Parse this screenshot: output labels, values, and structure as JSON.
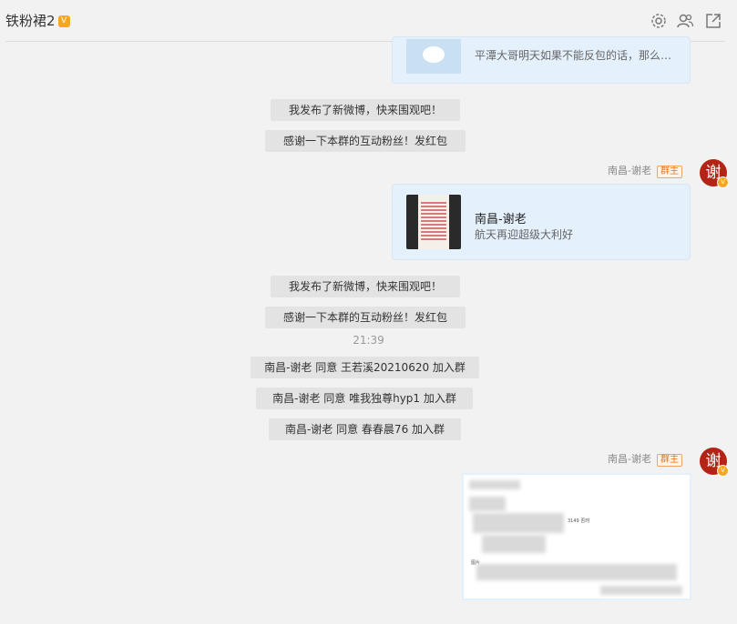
{
  "header": {
    "title": "铁粉裙2",
    "settings_icon": "gear-icon",
    "members_icon": "people-icon",
    "popout_icon": "external-link-icon"
  },
  "top_card": {
    "subtitle": "平潭大哥明天如果不能反包的话，那么…"
  },
  "system_messages": [
    "我发布了新微博，快来围观吧！",
    "感谢一下本群的互动粉丝！发红包",
    "我发布了新微博，快来围观吧！",
    "感谢一下本群的互动粉丝！发红包"
  ],
  "sender_1": {
    "name": "南昌-谢老",
    "role": "群主"
  },
  "card_1": {
    "title": "南昌-谢老",
    "subtitle": "航天再迎超级大利好"
  },
  "time_label": "21:39",
  "join_messages": [
    "南昌-谢老 同意 王若溪20210620 加入群",
    "南昌-谢老 同意 唯我独尊hyp1 加入群",
    "南昌-谢老 同意 春春晨76 加入群"
  ],
  "sender_2": {
    "name": "南昌-谢老",
    "role": "群主"
  },
  "avatar_glyph": "谢",
  "image_message": {
    "caption": "3149 否时",
    "label": "图片"
  },
  "colors": {
    "accent": "#f5a623",
    "card_bg": "#e4f0fb",
    "avatar_bg": "#b32416"
  }
}
